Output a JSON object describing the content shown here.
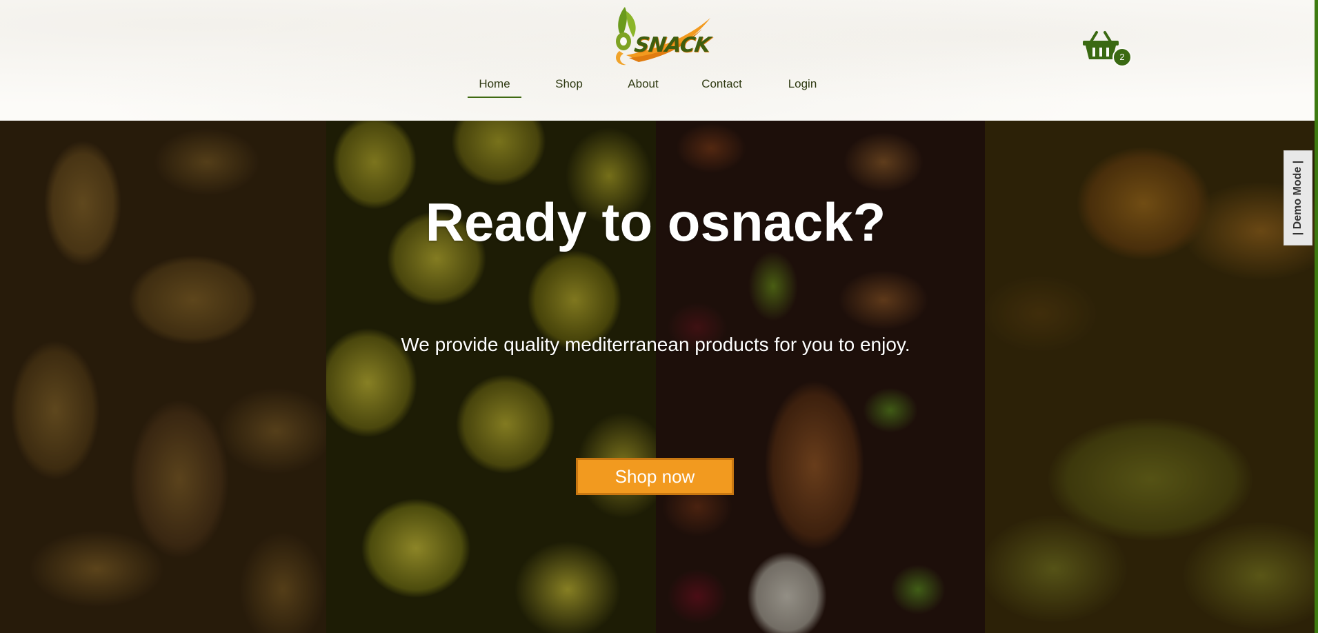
{
  "header": {
    "logo_text": "SNACK",
    "nav": [
      {
        "label": "Home",
        "active": true
      },
      {
        "label": "Shop",
        "active": false
      },
      {
        "label": "About",
        "active": false
      },
      {
        "label": "Contact",
        "active": false
      },
      {
        "label": "Login",
        "active": false
      }
    ],
    "cart": {
      "icon": "basket-icon",
      "count": "2"
    }
  },
  "hero": {
    "title": "Ready to osnack?",
    "subtitle": "We provide quality mediterranean products for you to enjoy.",
    "cta_label": "Shop now",
    "panels": [
      "cashews",
      "olives",
      "mixed nuts",
      "baklava"
    ]
  },
  "demo_tab": {
    "label": "| Demo Mode |"
  },
  "colors": {
    "brand_green": "#3a6912",
    "cta_orange": "#f29a1f",
    "nav_text": "#2f3a12"
  }
}
